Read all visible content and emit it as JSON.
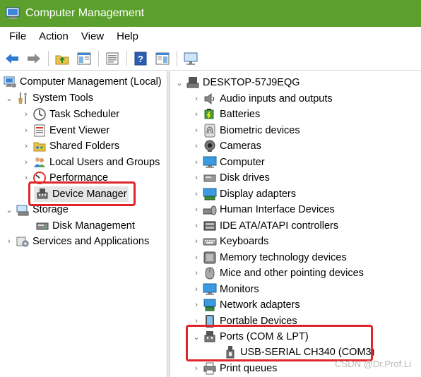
{
  "window": {
    "title": "Computer Management"
  },
  "menu": [
    "File",
    "Action",
    "View",
    "Help"
  ],
  "toolbar_icons": [
    "back-arrow-icon",
    "forward-arrow-icon",
    "up-folder-icon",
    "show-hide-tree-icon",
    "properties-icon",
    "help-icon",
    "show-hide-action-pane-icon",
    "monitor-icon"
  ],
  "left_tree": [
    {
      "label": "Computer Management (Local)",
      "icon": "computer-management-icon",
      "chevron": ""
    },
    {
      "label": "System Tools",
      "icon": "system-tools-icon",
      "chevron": "expanded"
    },
    {
      "label": "Task Scheduler",
      "icon": "clock-icon",
      "chevron": "collapsed"
    },
    {
      "label": "Event Viewer",
      "icon": "event-viewer-icon",
      "chevron": "collapsed"
    },
    {
      "label": "Shared Folders",
      "icon": "shared-folders-icon",
      "chevron": "collapsed"
    },
    {
      "label": "Local Users and Groups",
      "icon": "users-icon",
      "chevron": "collapsed"
    },
    {
      "label": "Performance",
      "icon": "performance-icon",
      "chevron": "collapsed"
    },
    {
      "label": "Device Manager",
      "icon": "device-manager-icon",
      "chevron": ""
    },
    {
      "label": "Storage",
      "icon": "storage-icon",
      "chevron": "expanded"
    },
    {
      "label": "Disk Management",
      "icon": "disk-management-icon",
      "chevron": ""
    },
    {
      "label": "Services and Applications",
      "icon": "services-icon",
      "chevron": "collapsed"
    }
  ],
  "right_tree": [
    {
      "label": "DESKTOP-57J9EQG",
      "icon": "computer-icon",
      "chevron": "expanded"
    },
    {
      "label": "Audio inputs and outputs",
      "icon": "speaker-icon",
      "chevron": "collapsed"
    },
    {
      "label": "Batteries",
      "icon": "battery-icon",
      "chevron": "collapsed"
    },
    {
      "label": "Biometric devices",
      "icon": "fingerprint-icon",
      "chevron": "collapsed"
    },
    {
      "label": "Cameras",
      "icon": "camera-icon",
      "chevron": "collapsed"
    },
    {
      "label": "Computer",
      "icon": "monitor-icon",
      "chevron": "collapsed"
    },
    {
      "label": "Disk drives",
      "icon": "disk-drive-icon",
      "chevron": "collapsed"
    },
    {
      "label": "Display adapters",
      "icon": "display-adapter-icon",
      "chevron": "collapsed"
    },
    {
      "label": "Human Interface Devices",
      "icon": "hid-icon",
      "chevron": "collapsed"
    },
    {
      "label": "IDE ATA/ATAPI controllers",
      "icon": "ide-controller-icon",
      "chevron": "collapsed"
    },
    {
      "label": "Keyboards",
      "icon": "keyboard-icon",
      "chevron": "collapsed"
    },
    {
      "label": "Memory technology devices",
      "icon": "memory-icon",
      "chevron": "collapsed"
    },
    {
      "label": "Mice and other pointing devices",
      "icon": "mouse-icon",
      "chevron": "collapsed"
    },
    {
      "label": "Monitors",
      "icon": "monitor-icon",
      "chevron": "collapsed"
    },
    {
      "label": "Network adapters",
      "icon": "network-icon",
      "chevron": "collapsed"
    },
    {
      "label": "Portable Devices",
      "icon": "portable-device-icon",
      "chevron": "collapsed"
    },
    {
      "label": "Ports (COM & LPT)",
      "icon": "port-icon",
      "chevron": "expanded"
    },
    {
      "label": "USB-SERIAL CH340 (COM3)",
      "icon": "port-icon",
      "chevron": ""
    },
    {
      "label": "Print queues",
      "icon": "printer-icon",
      "chevron": "collapsed"
    }
  ],
  "watermark": "CSDN @Dr.Prof.Li",
  "colors": {
    "titlebar": "#5ba02c",
    "highlight_box": "#e0262a",
    "selection": "#e5e5e5"
  }
}
